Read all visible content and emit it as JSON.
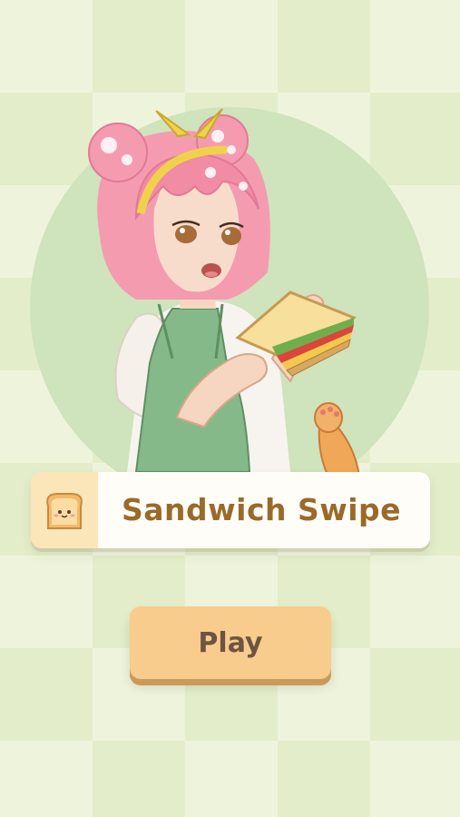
{
  "title_banner": {
    "icon": "toast-icon",
    "title": "Sandwich Swipe"
  },
  "play_button": {
    "label": "Play"
  },
  "hero": {
    "character": "girl-eating-sandwich-illustration",
    "companion": "cat-paw-illustration"
  },
  "colors": {
    "background_light": "#eef4dc",
    "background_dark": "#e3edc9",
    "hero_circle": "#cfe3bd",
    "title_text": "#9a6a2a",
    "button_fill": "#f7cc8c",
    "button_shadow": "#c99a5a",
    "button_text": "#6f5444"
  }
}
